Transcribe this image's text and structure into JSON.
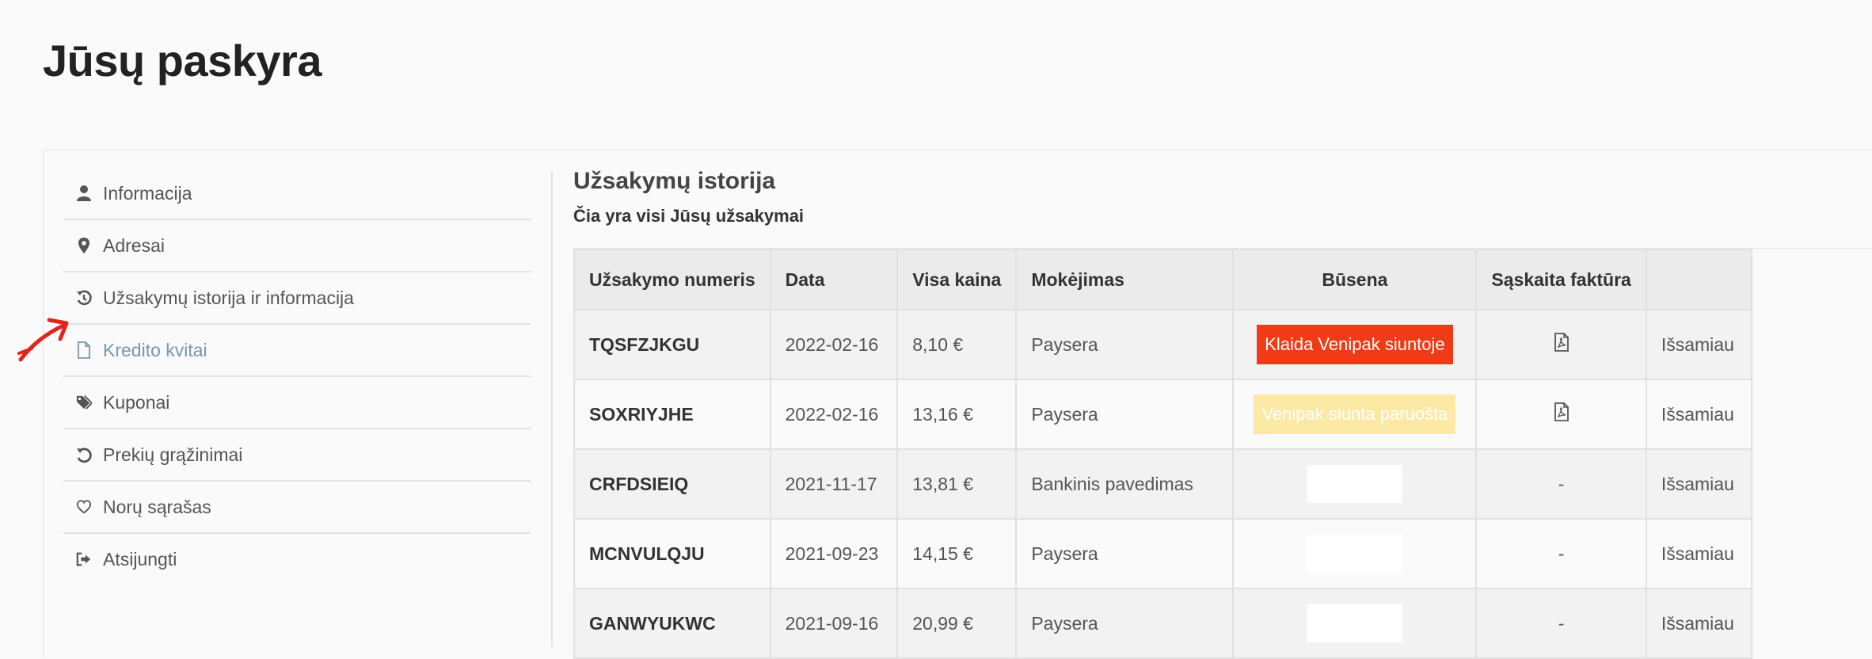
{
  "page": {
    "title": "Jūsų paskyra"
  },
  "sidebar": {
    "items": [
      {
        "label": "Informacija",
        "icon": "user-icon"
      },
      {
        "label": "Adresai",
        "icon": "map-pin-icon"
      },
      {
        "label": "Užsakymų istorija ir informacija",
        "icon": "history-icon"
      },
      {
        "label": "Kredito kvitai",
        "icon": "document-icon",
        "active": true
      },
      {
        "label": "Kuponai",
        "icon": "tags-icon"
      },
      {
        "label": "Prekių grąžinimai",
        "icon": "undo-icon"
      },
      {
        "label": "Norų sąrašas",
        "icon": "heart-icon"
      },
      {
        "label": "Atsijungti",
        "icon": "sign-out-icon"
      }
    ]
  },
  "content": {
    "title": "Užsakymų istorija",
    "subtitle": "Čia yra visi Jūsų užsakymai"
  },
  "table": {
    "headers": [
      "Užsakymo numeris",
      "Data",
      "Visa kaina",
      "Mokėjimas",
      "Būsena",
      "Sąskaita faktūra",
      ""
    ],
    "rows": [
      {
        "number": "TQSFZJKGU",
        "date": "2022-02-16",
        "price": "8,10 €",
        "payment": "Paysera",
        "status": "Klaida Venipak siuntoje",
        "status_color": "#f03b16",
        "invoice": "pdf",
        "action": "Išsamiau"
      },
      {
        "number": "SOXRIYJHE",
        "date": "2022-02-16",
        "price": "13,16 €",
        "payment": "Paysera",
        "status": "Venipak siunta paruošta",
        "status_color": "#fde9a6",
        "invoice": "pdf",
        "action": "Išsamiau"
      },
      {
        "number": "CRFDSIEIQ",
        "date": "2021-11-17",
        "price": "13,81 €",
        "payment": "Bankinis pavedimas",
        "status": "",
        "status_color": "#ffffff",
        "invoice": "-",
        "action": "Išsamiau"
      },
      {
        "number": "MCNVULQJU",
        "date": "2021-09-23",
        "price": "14,15 €",
        "payment": "Paysera",
        "status": "",
        "status_color": "#ffffff",
        "invoice": "-",
        "action": "Išsamiau"
      },
      {
        "number": "GANWYUKWC",
        "date": "2021-09-16",
        "price": "20,99 €",
        "payment": "Paysera",
        "status": "",
        "status_color": "#ffffff",
        "invoice": "-",
        "action": "Išsamiau"
      }
    ]
  },
  "colors": {
    "active_link": "#7a96b3",
    "annotation": "#e0251b"
  }
}
